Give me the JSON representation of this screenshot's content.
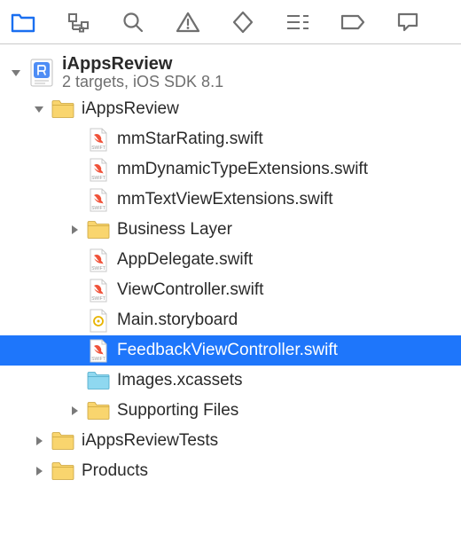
{
  "toolbar": {
    "items": [
      {
        "name": "project-navigator-icon",
        "active": true
      },
      {
        "name": "symbol-navigator-icon",
        "active": false
      },
      {
        "name": "find-navigator-icon",
        "active": false
      },
      {
        "name": "issue-navigator-icon",
        "active": false
      },
      {
        "name": "test-navigator-icon",
        "active": false
      },
      {
        "name": "debug-navigator-icon",
        "active": false
      },
      {
        "name": "breakpoint-navigator-icon",
        "active": false
      },
      {
        "name": "report-navigator-icon",
        "active": false
      }
    ]
  },
  "project": {
    "name": "iAppsReview",
    "subtitle": "2 targets, iOS SDK 8.1"
  },
  "tree": [
    {
      "level": 0,
      "kind": "project",
      "disclosure": "open"
    },
    {
      "level": 1,
      "kind": "folder",
      "disclosure": "open",
      "label": "iAppsReview"
    },
    {
      "level": 2,
      "kind": "swift",
      "disclosure": "none",
      "label": "mmStarRating.swift"
    },
    {
      "level": 2,
      "kind": "swift",
      "disclosure": "none",
      "label": "mmDynamicTypeExtensions.swift"
    },
    {
      "level": 2,
      "kind": "swift",
      "disclosure": "none",
      "label": "mmTextViewExtensions.swift"
    },
    {
      "level": 2,
      "kind": "folder",
      "disclosure": "closed",
      "label": "Business Layer"
    },
    {
      "level": 2,
      "kind": "swift",
      "disclosure": "none",
      "label": "AppDelegate.swift"
    },
    {
      "level": 2,
      "kind": "swift",
      "disclosure": "none",
      "label": "ViewController.swift"
    },
    {
      "level": 2,
      "kind": "storyboard",
      "disclosure": "none",
      "label": "Main.storyboard"
    },
    {
      "level": 2,
      "kind": "swift",
      "disclosure": "none",
      "label": "FeedbackViewController.swift",
      "selected": true
    },
    {
      "level": 2,
      "kind": "assets",
      "disclosure": "none",
      "label": "Images.xcassets"
    },
    {
      "level": 2,
      "kind": "folder",
      "disclosure": "closed",
      "label": "Supporting Files"
    },
    {
      "level": 1,
      "kind": "folder",
      "disclosure": "closed",
      "label": "iAppsReviewTests"
    },
    {
      "level": 1,
      "kind": "folder",
      "disclosure": "closed",
      "label": "Products"
    }
  ]
}
